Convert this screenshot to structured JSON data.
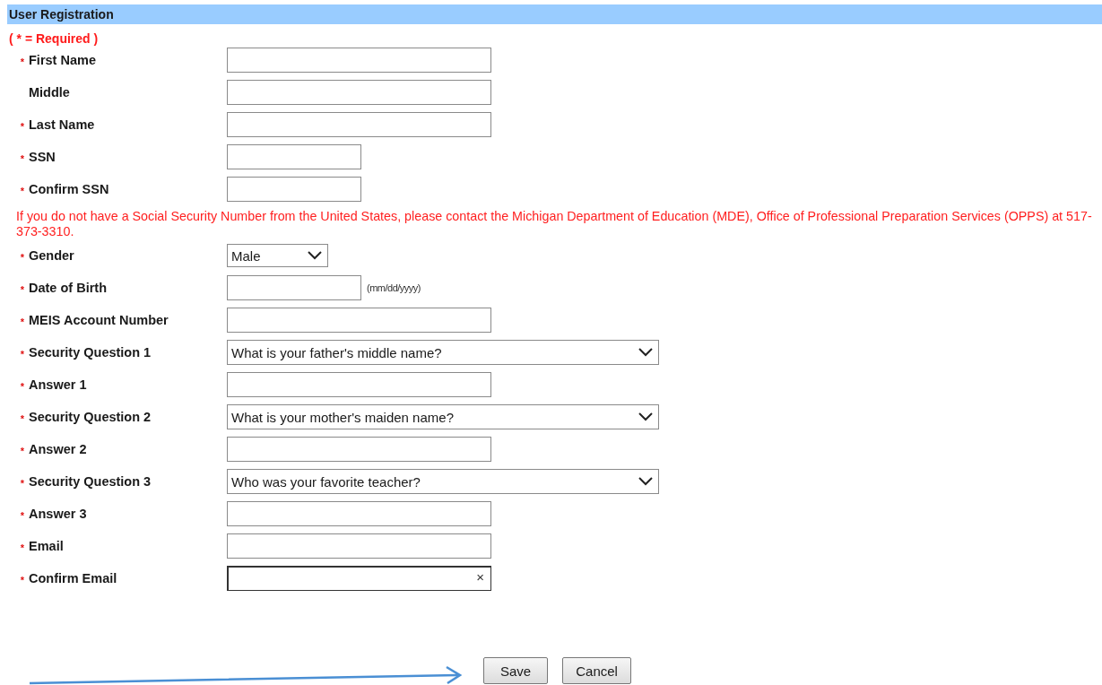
{
  "header": {
    "title": "User Registration"
  },
  "required_note": "( * = Required )",
  "rows": [
    {
      "kind": "text",
      "marker": "*",
      "label": "First Name"
    },
    {
      "kind": "text",
      "label": "Middle"
    },
    {
      "kind": "text",
      "marker": "*",
      "label": "Last Name"
    },
    {
      "kind": "short-text",
      "marker": "*",
      "label": "SSN"
    },
    {
      "kind": "short-text",
      "marker": "*",
      "label": "Confirm SSN"
    },
    {
      "kind": "note",
      "text": "If you do not have a Social Security Number from the United States, please contact the Michigan Department of Education (MDE), Office of Professional Preparation Services (OPPS) at 517-373-3310."
    },
    {
      "kind": "short-select",
      "marker": "*",
      "label": "Gender",
      "value": "Male"
    },
    {
      "kind": "date",
      "marker": "*",
      "label": "Date of Birth",
      "hint": "(mm/dd/yyyy)"
    },
    {
      "kind": "text",
      "marker": "*",
      "label": "MEIS Account Number"
    },
    {
      "kind": "select",
      "marker": "*",
      "label": "Security Question 1",
      "value": "What is your father's middle name?"
    },
    {
      "kind": "text",
      "marker": "*",
      "label": "Answer 1"
    },
    {
      "kind": "select",
      "marker": "*",
      "label": "Security Question 2",
      "value": "What is your mother's maiden name?"
    },
    {
      "kind": "text",
      "marker": "*",
      "label": "Answer 2"
    },
    {
      "kind": "select",
      "marker": "*",
      "label": "Security Question 3",
      "value": "Who was your favorite teacher?"
    },
    {
      "kind": "text",
      "marker": "*",
      "label": "Answer 3"
    },
    {
      "kind": "text",
      "marker": "*",
      "label": "Email"
    },
    {
      "kind": "clearable",
      "marker": "*",
      "label": "Confirm Email",
      "clear": "×"
    }
  ],
  "buttons": [
    "Save",
    "Cancel"
  ]
}
